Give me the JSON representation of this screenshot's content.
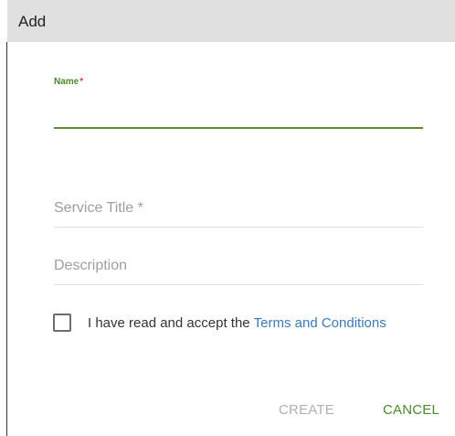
{
  "dialog": {
    "title": "Add"
  },
  "form": {
    "name": {
      "label": "Name",
      "required_mark": "*",
      "value": ""
    },
    "service_title": {
      "placeholder": "Service Title *"
    },
    "description": {
      "placeholder": "Description"
    },
    "terms": {
      "checked": false,
      "text": "I have read and accept the",
      "link_text": "Terms and Conditions"
    }
  },
  "actions": {
    "create_label": "CREATE",
    "cancel_label": "CANCEL"
  },
  "colors": {
    "accent": "#4a8a2a",
    "required": "#e53935",
    "link": "#3a7ab8",
    "header_bg": "#e0e0e0",
    "disabled": "#b0b0b0"
  },
  "icons": {
    "terms_checkbox": "checkbox-unchecked-icon"
  }
}
